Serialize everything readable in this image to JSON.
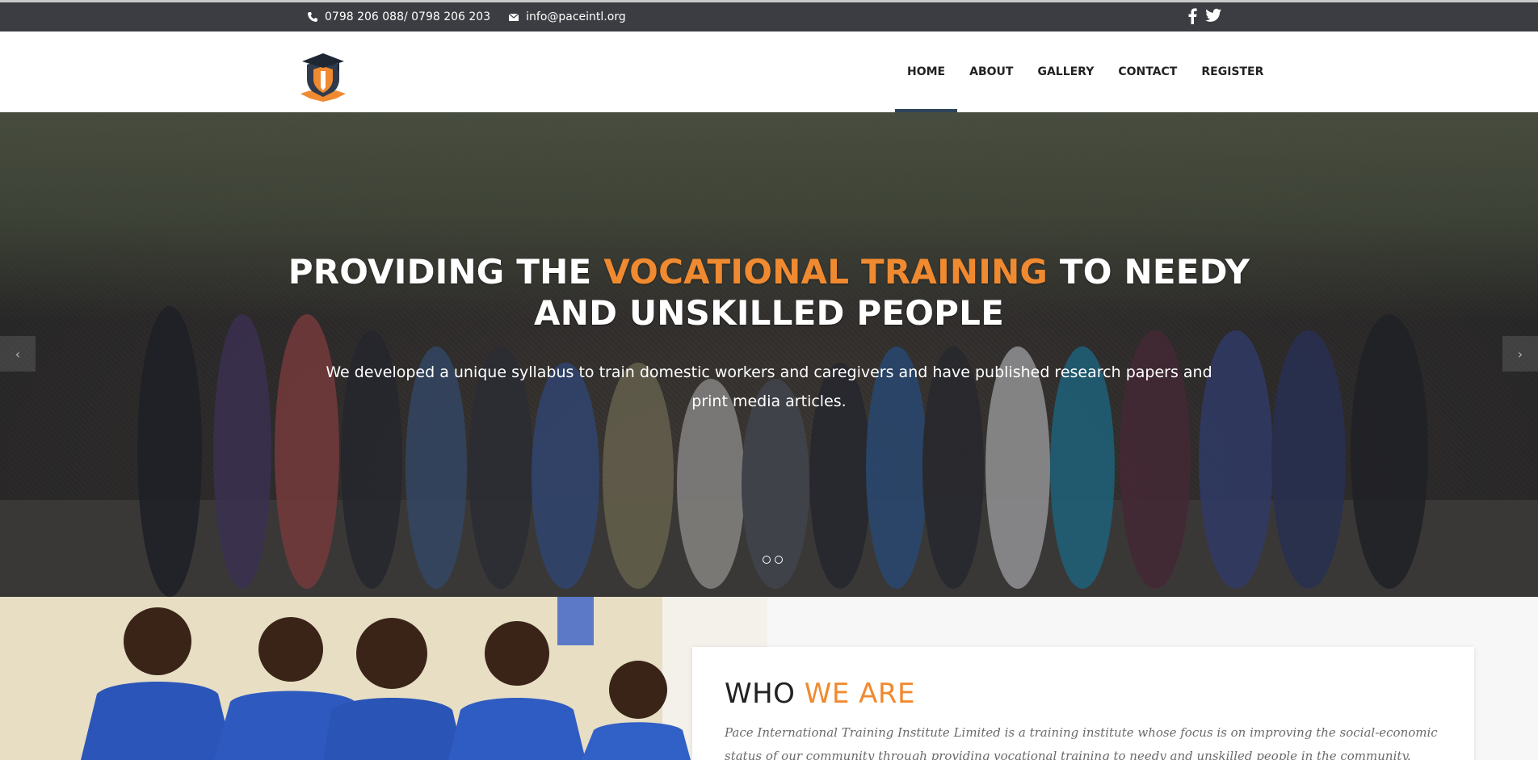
{
  "topbar": {
    "phone": "0798 206 088/ 0798 206 203",
    "email": "info@paceintl.org",
    "icons": [
      "phone-icon",
      "envelope-icon",
      "facebook-icon",
      "twitter-icon"
    ]
  },
  "nav": {
    "items": [
      "HOME",
      "ABOUT",
      "GALLERY",
      "CONTACT",
      "REGISTER"
    ],
    "active": "HOME"
  },
  "hero": {
    "title_part1": "PROVIDING THE ",
    "title_accent": "VOCATIONAL TRAINING",
    "title_part2": " TO NEEDY AND UNSKILLED PEOPLE",
    "subtitle": "We developed a unique syllabus to train domestic workers and caregivers and have published research papers and print media articles.",
    "slides": 2
  },
  "about": {
    "title_part1": "WHO ",
    "title_accent": "WE ARE",
    "description": "Pace International Training Institute Limited is a training institute whose focus is on improving the social-economic status of our community through providing vocational training to needy and unskilled people in the community."
  },
  "colors": {
    "accent": "#f08a30",
    "topbar_bg": "#3b3d42",
    "nav_active_bar": "#2d4459"
  }
}
